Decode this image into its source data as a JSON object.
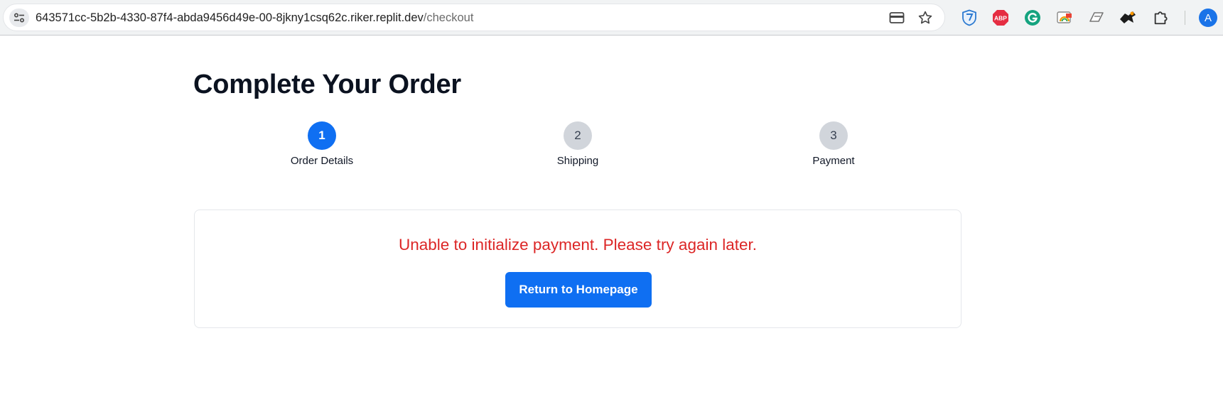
{
  "browser": {
    "url_host": "643571cc-5b2b-4330-87f4-abda9456d49e-00-8jkny1csq62c.riker.replit.dev",
    "url_path": "/checkout",
    "site_info_icon": "tune-icon",
    "omnibox_icons": [
      "card-icon",
      "star-icon"
    ],
    "extensions": [
      "shield-ext-icon",
      "abp-ext-icon",
      "grammarly-ext-icon",
      "rainbow-ext-icon",
      "window-ext-icon",
      "bird-ext-icon",
      "puzzle-icon"
    ],
    "abp_label": "ABP",
    "avatar_letter": "A",
    "colors": {
      "accent": "#1a73e8"
    }
  },
  "page": {
    "title": "Complete Your Order"
  },
  "steps": [
    {
      "number": "1",
      "label": "Order Details",
      "state": "active"
    },
    {
      "number": "2",
      "label": "Shipping",
      "state": "inactive"
    },
    {
      "number": "3",
      "label": "Payment",
      "state": "inactive"
    }
  ],
  "card": {
    "error_message": "Unable to initialize payment. Please try again later.",
    "button_label": "Return to Homepage"
  },
  "colors": {
    "primary": "#0f6ff2",
    "error": "#dc2626",
    "inactive_step": "#d1d5db"
  }
}
